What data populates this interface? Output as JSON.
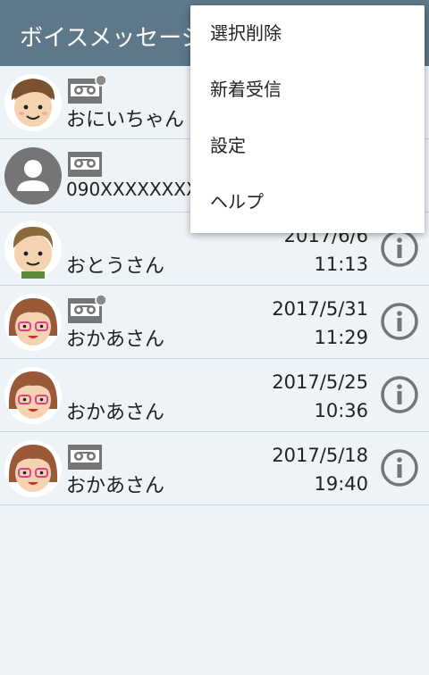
{
  "appbar": {
    "title": "ボイスメッセージ"
  },
  "messages": [
    {
      "name": "おにいちゃん",
      "avatar": "boy-avatar",
      "has_voicemail": true,
      "unread": true,
      "date": "",
      "time": ""
    },
    {
      "name": "090XXXXXXXX",
      "avatar": "default-person-avatar",
      "has_voicemail": true,
      "unread": false,
      "date": "",
      "time": ""
    },
    {
      "name": "おとうさん",
      "avatar": "man-avatar",
      "has_voicemail": false,
      "unread": false,
      "date": "2017/6/6",
      "time": "11:13"
    },
    {
      "name": "おかあさん",
      "avatar": "woman-avatar",
      "has_voicemail": true,
      "unread": true,
      "date": "2017/5/31",
      "time": "11:29"
    },
    {
      "name": "おかあさん",
      "avatar": "woman-avatar",
      "has_voicemail": false,
      "unread": false,
      "date": "2017/5/25",
      "time": "10:36"
    },
    {
      "name": "おかあさん",
      "avatar": "woman-avatar",
      "has_voicemail": true,
      "unread": false,
      "date": "2017/5/18",
      "time": "19:40"
    }
  ],
  "overflow_menu": {
    "items": [
      {
        "label": "選択削除"
      },
      {
        "label": "新着受信"
      },
      {
        "label": "設定"
      },
      {
        "label": "ヘルプ"
      }
    ]
  },
  "colors": {
    "appbar": "#5e7889",
    "background": "#eef3f8",
    "icon_gray": "#757575"
  }
}
